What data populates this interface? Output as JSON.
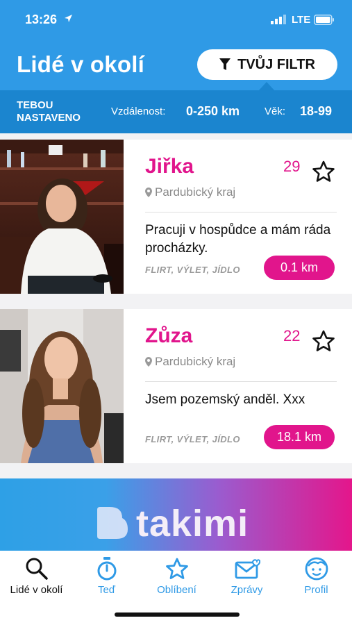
{
  "status_bar": {
    "time": "13:26",
    "network": "LTE"
  },
  "header": {
    "title": "Lidé v okolí",
    "filter_button": "TVŮJ FILTR"
  },
  "settings": {
    "label": "TEBOU NASTAVENO",
    "distance_label": "Vzdálenost:",
    "distance_value": "0-250 km",
    "age_label": "Věk:",
    "age_value": "18-99"
  },
  "profiles": [
    {
      "name": "Jiřka",
      "age": "29",
      "region": "Pardubický kraj",
      "bio": "Pracuji v hospůdce a mám ráda procházky.",
      "tags": "FLIRT, VÝLET, JÍDLO",
      "distance": "0.1 km",
      "favorite": false
    },
    {
      "name": "Zůza",
      "age": "22",
      "region": "Pardubický kraj",
      "bio": "Jsem pozemský anděl. Xxx",
      "tags": "FLIRT, VÝLET, JÍDLO",
      "distance": "18.1 km",
      "favorite": false
    }
  ],
  "banner": {
    "brand": "takimi"
  },
  "tabs": [
    {
      "label": "Lidé v okolí",
      "icon": "search-icon",
      "active": true
    },
    {
      "label": "Teď",
      "icon": "stopwatch-icon",
      "active": false
    },
    {
      "label": "Oblíbení",
      "icon": "star-icon",
      "active": false
    },
    {
      "label": "Zprávy",
      "icon": "mail-heart-icon",
      "active": false
    },
    {
      "label": "Profil",
      "icon": "face-icon",
      "active": false
    }
  ],
  "colors": {
    "primary_blue": "#2f9ae6",
    "dark_blue": "#1b85cf",
    "accent_pink": "#e1158c"
  }
}
